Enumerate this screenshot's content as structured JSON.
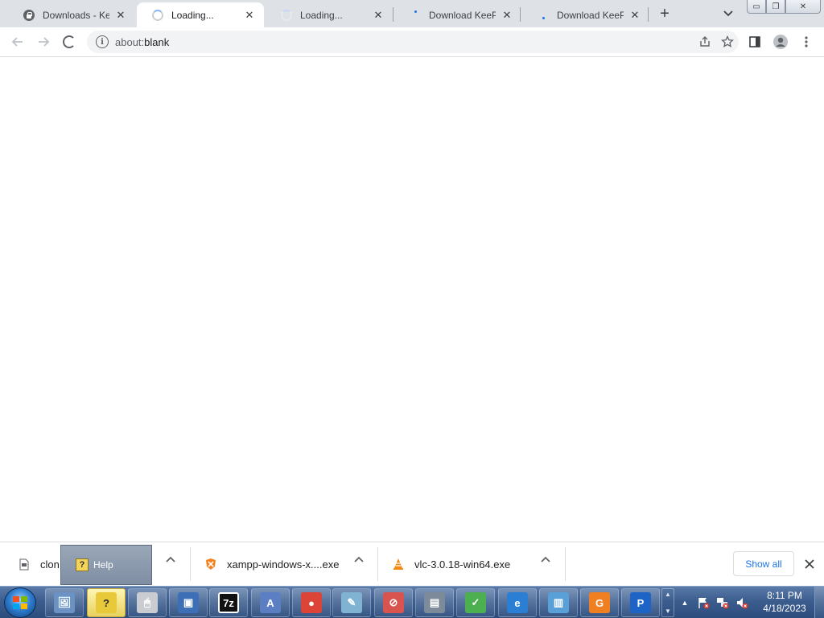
{
  "browser": {
    "tabs": [
      {
        "title": "Downloads - KeeP",
        "icon": "lock-icon",
        "active": false
      },
      {
        "title": "Loading...",
        "icon": "loading-spinner-icon",
        "active": true
      },
      {
        "title": "Loading...",
        "icon": "loading-spinner-icon",
        "active": false
      },
      {
        "title": "Download KeePas",
        "icon": "loading-dot-icon",
        "active": false
      },
      {
        "title": "Download KeePas",
        "icon": "loading-dot-icon",
        "active": false
      }
    ],
    "close_glyph": "✕",
    "new_tab_glyph": "+",
    "tab_search_glyph": "⌄",
    "window": {
      "minimize_glyph": "▭",
      "maximize_glyph": "❐",
      "close_glyph": "✕"
    }
  },
  "toolbar": {
    "back_glyph": "←",
    "forward_glyph": "→",
    "stop_glyph": "✕",
    "info_glyph": "i",
    "url_prefix": "about:",
    "url_rest": "blank",
    "share_glyph": "⇪",
    "bookmark_glyph": "☆",
    "sidepanel_glyph": "◨",
    "profile_glyph": "●",
    "menu_glyph": "⋮"
  },
  "downloads": {
    "items": [
      {
        "name": "clon",
        "icon": "file-icon"
      },
      {
        "name": "xampp-windows-x....exe",
        "icon": "xampp-icon"
      },
      {
        "name": "vlc-3.0.18-win64.exe",
        "icon": "vlc-icon"
      }
    ],
    "chevron_glyph": "⌃",
    "show_all_label": "Show all",
    "close_glyph": "✕"
  },
  "help_popup": {
    "label": "Help",
    "icon_glyph": "?"
  },
  "taskbar": {
    "apps": [
      {
        "name": "photo-viewer",
        "glyph": "🖼",
        "color": "#6a93c4"
      },
      {
        "name": "help-and-support",
        "glyph": "?",
        "color": "#e8c93a"
      },
      {
        "name": "mouse-settings",
        "glyph": "🖱",
        "color": "#c9ccd1"
      },
      {
        "name": "display-settings",
        "glyph": "▣",
        "color": "#3d6fb6"
      },
      {
        "name": "7zip",
        "glyph": "7z",
        "color": "#111111"
      },
      {
        "name": "vector-app",
        "glyph": "A",
        "color": "#5b7fc2"
      },
      {
        "name": "chrome",
        "glyph": "●",
        "color": "#db4437"
      },
      {
        "name": "notepad",
        "glyph": "✎",
        "color": "#7fb3d1"
      },
      {
        "name": "blocked-app",
        "glyph": "⊘",
        "color": "#d9534f"
      },
      {
        "name": "archive-app",
        "glyph": "▤",
        "color": "#7d8a99"
      },
      {
        "name": "spreadsheet-editor",
        "glyph": "✓",
        "color": "#4caf50"
      },
      {
        "name": "internet-explorer",
        "glyph": "e",
        "color": "#2a7fd4"
      },
      {
        "name": "remote-desktop",
        "glyph": "▥",
        "color": "#5aa0d8"
      },
      {
        "name": "pdf-app",
        "glyph": "G",
        "color": "#f07f22"
      },
      {
        "name": "p-app",
        "glyph": "P",
        "color": "#1e63c6"
      }
    ],
    "tray_up_glyph": "▲",
    "clock_time": "8:11 PM",
    "clock_date": "4/18/2023"
  }
}
